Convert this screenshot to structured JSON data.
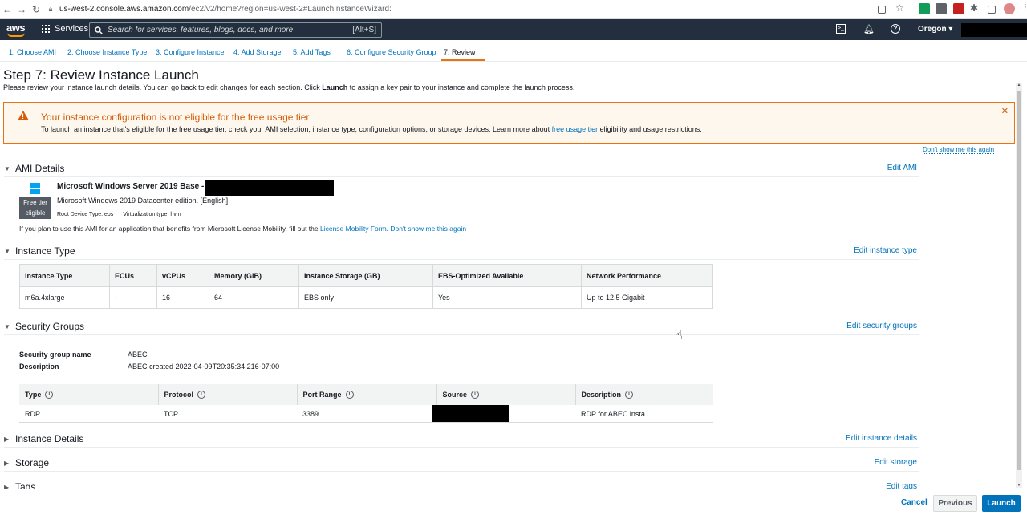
{
  "browser": {
    "url_host": "us-west-2.console.aws.amazon.com",
    "url_path": "/ec2/v2/home?region=us-west-2#LaunchInstanceWizard:"
  },
  "topnav": {
    "logo": "aws",
    "services": "Services",
    "search_placeholder": "Search for services, features, blogs, docs, and more",
    "search_shortcut": "[Alt+S]",
    "region": "Oregon ▾"
  },
  "wizard_tabs": [
    "1. Choose AMI",
    "2. Choose Instance Type",
    "3. Configure Instance",
    "4. Add Storage",
    "5. Add Tags",
    "6. Configure Security Group",
    "7. Review"
  ],
  "page": {
    "title": "Step 7: Review Instance Launch",
    "subtitle_pre": "Please review your instance launch details. You can go back to edit changes for each section. Click ",
    "subtitle_bold": "Launch",
    "subtitle_post": " to assign a key pair to your instance and complete the launch process."
  },
  "warning": {
    "title": "Your instance configuration is not eligible for the free usage tier",
    "body_pre": "To launch an instance that's eligible for the free usage tier, check your AMI selection, instance type, configuration options, or storage devices. Learn more about ",
    "body_link": "free usage tier",
    "body_post": " eligibility and usage restrictions.",
    "dont_show": "Don't show me this again"
  },
  "ami": {
    "section_title": "AMI Details",
    "edit": "Edit AMI",
    "name": "Microsoft Windows Server 2019 Base -",
    "badge_line1": "Free tier",
    "badge_line2": "eligible",
    "description": "Microsoft Windows 2019 Datacenter edition. [English]",
    "root_device": "Root Device Type: ebs",
    "virtualization": "Virtualization type: hvm",
    "note_pre": "If you plan to use this AMI for an application that benefits from Microsoft License Mobility, fill out the ",
    "note_link": "License Mobility Form",
    "note_sep": ". ",
    "note_link2": "Don't show me this again"
  },
  "instance_type": {
    "section_title": "Instance Type",
    "edit": "Edit instance type",
    "headers": [
      "Instance Type",
      "ECUs",
      "vCPUs",
      "Memory (GiB)",
      "Instance Storage (GB)",
      "EBS-Optimized Available",
      "Network Performance"
    ],
    "row": [
      "m6a.4xlarge",
      "-",
      "16",
      "64",
      "EBS only",
      "Yes",
      "Up to 12.5 Gigabit"
    ]
  },
  "security_groups": {
    "section_title": "Security Groups",
    "edit": "Edit security groups",
    "name_label": "Security group name",
    "name_value": "ABEC",
    "desc_label": "Description",
    "desc_value": "ABEC created 2022-04-09T20:35:34.216-07:00",
    "headers": [
      "Type",
      "Protocol",
      "Port Range",
      "Source",
      "Description"
    ],
    "row": [
      "RDP",
      "TCP",
      "3389",
      "",
      "RDP for ABEC insta..."
    ]
  },
  "instance_details": {
    "section_title": "Instance Details",
    "edit": "Edit instance details"
  },
  "storage": {
    "section_title": "Storage",
    "edit": "Edit storage"
  },
  "tags": {
    "section_title": "Tags",
    "edit": "Edit tags"
  },
  "footer": {
    "cancel": "Cancel",
    "previous": "Previous",
    "launch": "Launch"
  }
}
